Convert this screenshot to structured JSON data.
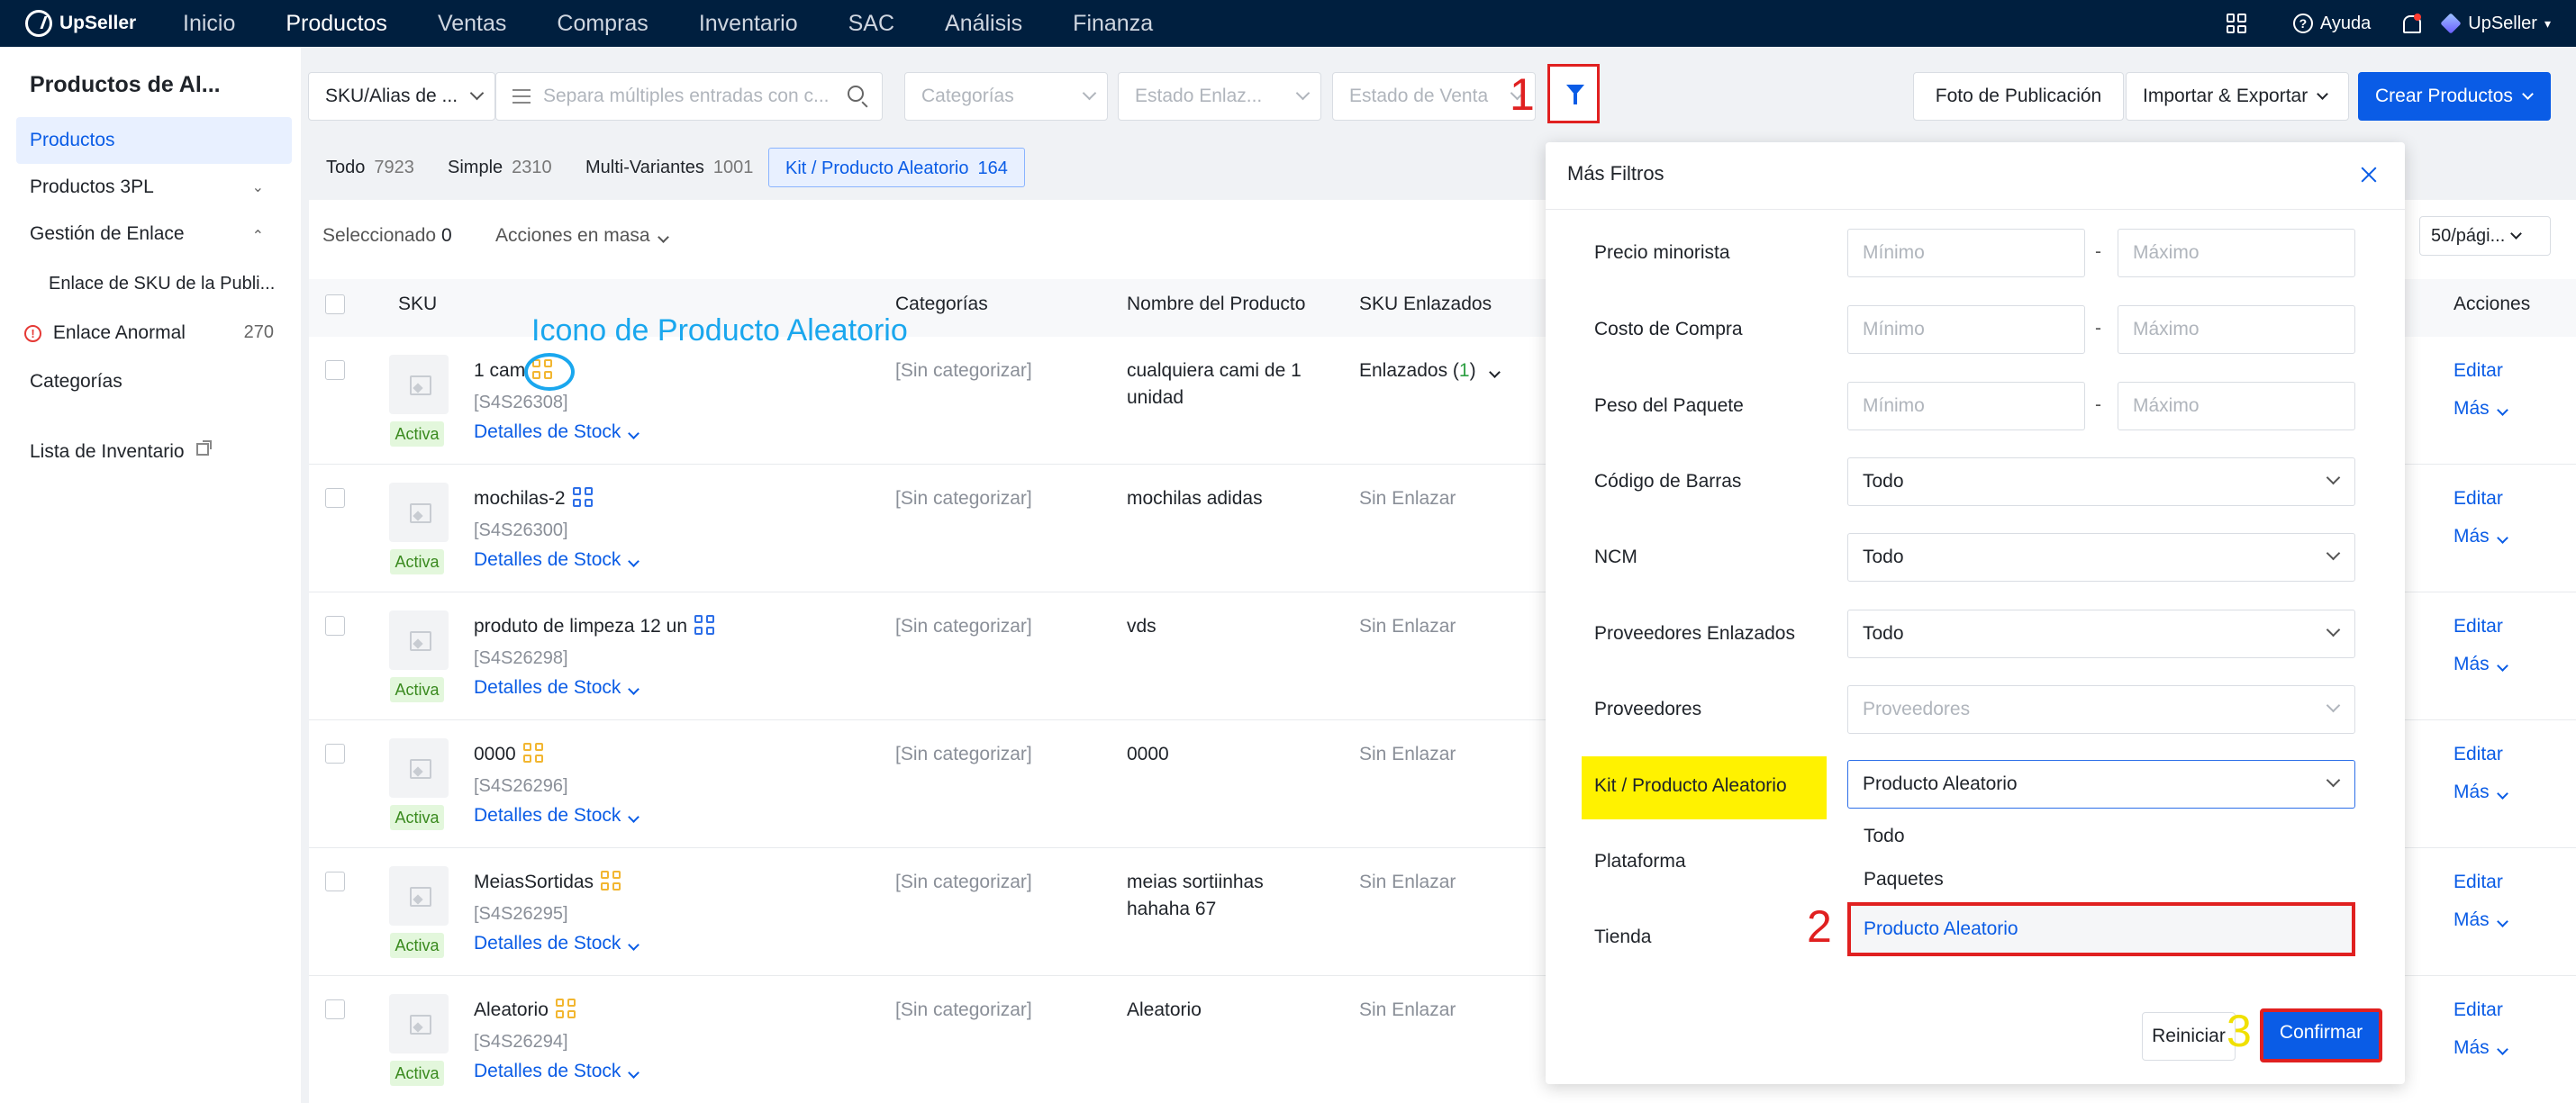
{
  "nav": {
    "brand": "UpSeller",
    "items": [
      "Inicio",
      "Productos",
      "Ventas",
      "Compras",
      "Inventario",
      "SAC",
      "Análisis",
      "Finanza"
    ],
    "active_index": 1,
    "help": "Ayuda",
    "user": "UpSeller",
    "colors": {
      "bar": "#001f3f",
      "accent": "#0a5ce6"
    }
  },
  "sidebar": {
    "title": "Productos de Al...",
    "items": {
      "productos": "Productos",
      "productos_3pl": "Productos 3PL",
      "gestion_enlace": "Gestión de Enlace",
      "enlace_sku": "Enlace de SKU de la Publi...",
      "enlace_anormal": "Enlace Anormal",
      "enlace_anormal_count": "270",
      "categorias": "Categorías",
      "lista_inventario": "Lista de Inventario"
    }
  },
  "filters": {
    "sku_select": "SKU/Alias de ...",
    "search_placeholder": "Separa múltiples entradas con c...",
    "categorias_placeholder": "Categorías",
    "estado_enlace_placeholder": "Estado Enlaz...",
    "estado_venta_placeholder": "Estado de Venta",
    "foto_btn": "Foto de Publicación",
    "import_btn": "Importar & Exportar",
    "create_btn": "Crear Productos"
  },
  "tabs": [
    {
      "label": "Todo",
      "count": "7923"
    },
    {
      "label": "Simple",
      "count": "2310"
    },
    {
      "label": "Multi-Variantes",
      "count": "1001"
    },
    {
      "label": "Kit / Producto Aleatorio",
      "count": "164"
    }
  ],
  "toolbar": {
    "selected_label": "Seleccionado",
    "selected_count": "0",
    "bulk_actions": "Acciones en masa",
    "page_size": "50/pági..."
  },
  "table": {
    "headers": {
      "sku": "SKU",
      "categorias": "Categorías",
      "nombre": "Nombre del Producto",
      "enlazados": "SKU Enlazados",
      "acciones": "Acciones"
    },
    "status_label": "Activa",
    "stock_link": "Detalles de Stock",
    "edit": "Editar",
    "more": "Más",
    "rows": [
      {
        "name": "1 cam",
        "sku": "[S4S26308]",
        "category": "[Sin categorizar]",
        "product_line1": "cualquiera cami de 1",
        "product_line2": "unidad",
        "link_prefix": "Enlazados (",
        "link_count": "1",
        "link_suffix": ")"
      },
      {
        "name": "mochilas-2",
        "sku": "[S4S26300]",
        "category": "[Sin categorizar]",
        "product_line1": "mochilas adidas",
        "product_line2": "",
        "link_status": "Sin Enlazar"
      },
      {
        "name": "produto de limpeza 12 un",
        "sku": "[S4S26298]",
        "category": "[Sin categorizar]",
        "product_line1": "vds",
        "product_line2": "",
        "link_status": "Sin Enlazar"
      },
      {
        "name": "0000",
        "sku": "[S4S26296]",
        "category": "[Sin categorizar]",
        "product_line1": "0000",
        "product_line2": "",
        "link_status": "Sin Enlazar"
      },
      {
        "name": "MeiasSortidas",
        "sku": "[S4S26295]",
        "category": "[Sin categorizar]",
        "product_line1": "meias sortiinhas",
        "product_line2": "hahaha 67",
        "link_status": "Sin Enlazar"
      },
      {
        "name": "Aleatorio",
        "sku": "[S4S26294]",
        "category": "[Sin categorizar]",
        "product_line1": "Aleatorio",
        "product_line2": "",
        "link_status": "Sin Enlazar"
      }
    ]
  },
  "panel": {
    "title": "Más Filtros",
    "fields": {
      "precio": "Precio minorista",
      "costo": "Costo de Compra",
      "peso": "Peso del Paquete",
      "codigo": "Código de Barras",
      "ncm": "NCM",
      "prov_enlazados": "Proveedores Enlazados",
      "proveedores": "Proveedores",
      "kit": "Kit / Producto Aleatorio",
      "plataforma": "Plataforma",
      "tienda": "Tienda"
    },
    "min_placeholder": "Mínimo",
    "max_placeholder": "Máximo",
    "range_sep": "-",
    "todo": "Todo",
    "proveedores_placeholder": "Proveedores",
    "kit_value": "Producto Aleatorio",
    "options": [
      "Todo",
      "Paquetes",
      "Producto Aleatorio"
    ],
    "reset": "Reiniciar",
    "confirm": "Confirmar"
  },
  "annotations": {
    "step1": "1",
    "step2": "2",
    "step3": "3",
    "icon_note": "Icono de Producto Aleatorio",
    "colors": {
      "red": "#e02020",
      "blue": "#1aa7ee",
      "yellow": "#fff200"
    }
  }
}
